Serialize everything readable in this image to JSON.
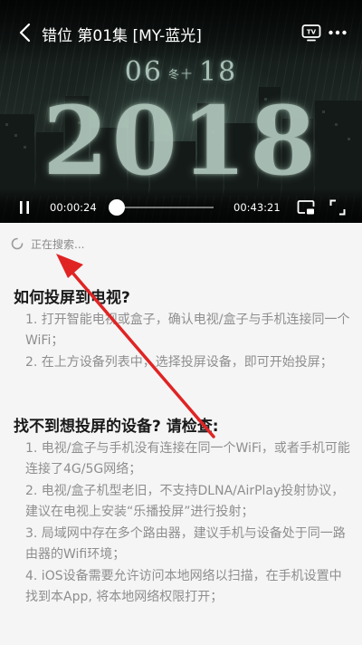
{
  "player": {
    "title": "错位 第01集 [MY-蓝光]",
    "frame_date_month": "06",
    "frame_date_sep": "冬十",
    "frame_date_day": "18",
    "frame_year": "2018",
    "current_time": "00:00:24",
    "duration": "00:43:21",
    "progress_fraction": 0.009,
    "icons": {
      "back": "chevron-left-icon",
      "tv": "tv-cast-icon",
      "more": "more-vertical-icon",
      "pause": "pause-icon",
      "pip": "picture-in-picture-icon",
      "fullscreen": "fullscreen-icon"
    }
  },
  "search": {
    "status": "正在搜索..."
  },
  "help": {
    "how_title": "如何投屏到电视?",
    "how_steps": [
      "1. 打开智能电视或盒子，确认电视/盒子与手机连接同一个WiFi；",
      "2. 在上方设备列表中，选择投屏设备，即可开始投屏；"
    ],
    "notfound_title": "找不到想投屏的设备? 请检查:",
    "notfound_steps": [
      "1. 电视/盒子与手机没有连接在同一个WiFi，或者手机可能连接了4G/5G网络；",
      "2. 电视/盒子机型老旧，不支持DLNA/AirPlay投射协议，建议在电视上安装“乐播投屏”进行投射；",
      "3. 局域网中存在多个路由器，建议手机与设备处于同一路由器的Wifi环境；",
      "4. iOS设备需要允许访问本地网络以扫描，在手机设置中找到本App, 将本地网络权限打开；"
    ]
  },
  "colors": {
    "annotation_arrow": "#e02424",
    "text_muted": "#8e8e8e",
    "heading": "#1a1a1a"
  }
}
